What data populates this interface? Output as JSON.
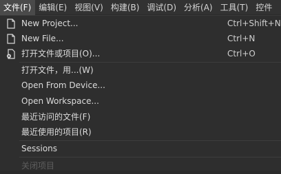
{
  "menubar": {
    "items": [
      {
        "label": "文件(F)"
      },
      {
        "label": "编辑(E)"
      },
      {
        "label": "视图(V)"
      },
      {
        "label": "构建(B)"
      },
      {
        "label": "调试(D)"
      },
      {
        "label": "分析(A)"
      },
      {
        "label": "工具(T)"
      },
      {
        "label": "控件"
      }
    ]
  },
  "file_menu": {
    "items": [
      {
        "label": "New Project...",
        "shortcut": "Ctrl+Shift+N",
        "icon": "new-project-icon"
      },
      {
        "label": "New File...",
        "shortcut": "Ctrl+N",
        "icon": "new-file-icon"
      },
      {
        "label": "打开文件或项目(O)...",
        "shortcut": "Ctrl+O",
        "icon": "open-file-icon"
      },
      {
        "label": "打开文件，用...(W)",
        "shortcut": ""
      },
      {
        "label": "Open From Device...",
        "shortcut": ""
      },
      {
        "label": "Open Workspace...",
        "shortcut": ""
      },
      {
        "label": "最近访问的文件(F)",
        "shortcut": ""
      },
      {
        "label": "最近使用的项目(R)",
        "shortcut": ""
      },
      {
        "label": "Sessions",
        "shortcut": ""
      },
      {
        "label": "关闭项目",
        "shortcut": "",
        "disabled": true
      }
    ]
  },
  "colors": {
    "background": "#2e2e2e",
    "menubar": "#323232",
    "active_item": "#4a4a4a",
    "text": "#dcdcdc",
    "disabled_text": "#5e5e5e"
  }
}
